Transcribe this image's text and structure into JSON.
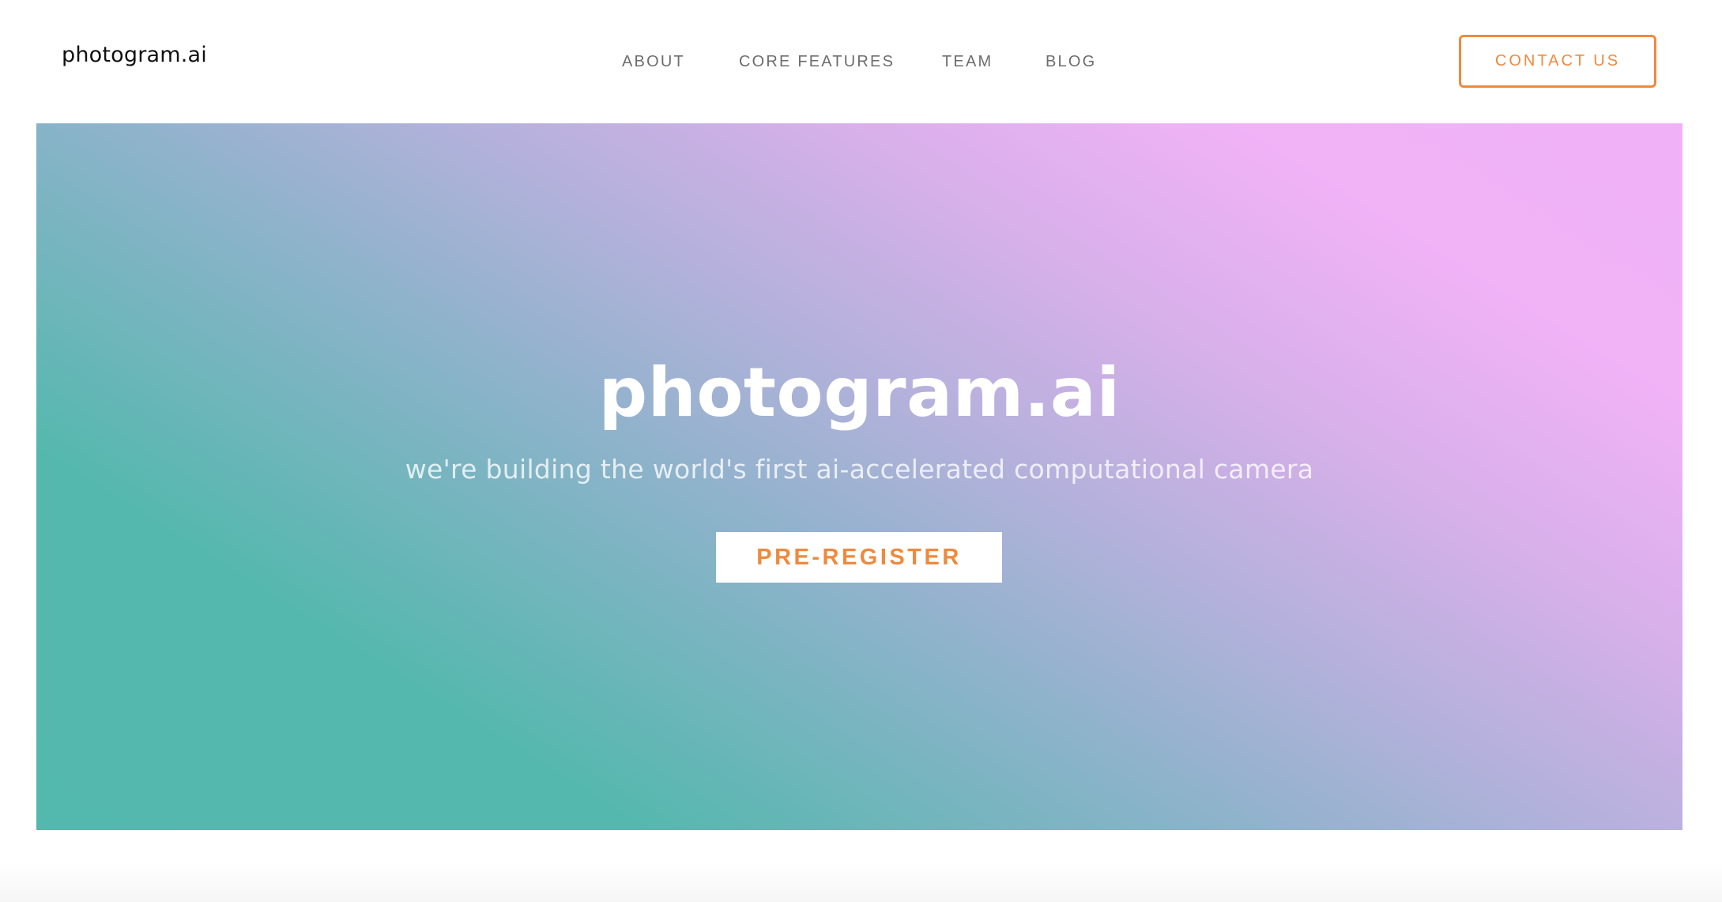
{
  "header": {
    "logo_text": "photogram.ai",
    "nav": {
      "about": "ABOUT",
      "core_features": "CORE FEATURES",
      "team": "TEAM",
      "blog": "BLOG"
    },
    "contact_label": "CONTACT US"
  },
  "hero": {
    "title": "photogram.ai",
    "subtitle": "we're building the world's first ai-accelerated computational camera",
    "cta_label": "PRE-REGISTER",
    "gradient_start_color": "#53b8ae",
    "gradient_end_color": "#f0b1f7"
  },
  "colors": {
    "accent": "#ee8a3e",
    "nav_text": "#6d6d6d",
    "logo_text": "#111111"
  }
}
